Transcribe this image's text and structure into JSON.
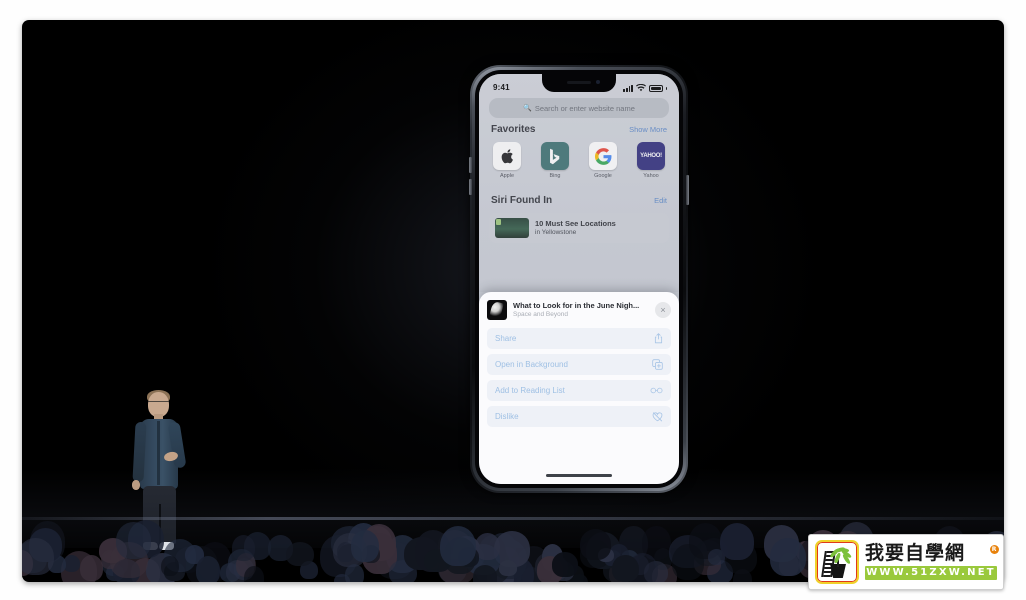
{
  "scene": {
    "description": "Apple WWDC keynote stage with presenter and large screen showing iPhone X Safari start page with context menu",
    "presenter_alt": "presenter standing on stage"
  },
  "phone": {
    "status_bar": {
      "time": "9:41",
      "signal_icon": "cellular-signal-icon",
      "wifi_icon": "wifi-icon",
      "battery_icon": "battery-full-icon"
    },
    "search": {
      "placeholder": "Search or enter website name",
      "icon": "search-icon"
    },
    "favorites": {
      "title": "Favorites",
      "action_label": "Show More",
      "items": [
        {
          "label": "Apple",
          "glyph": "apple-logo-icon"
        },
        {
          "label": "Bing",
          "glyph": "bing-logo-icon"
        },
        {
          "label": "Google",
          "glyph": "google-logo-icon"
        },
        {
          "label": "Yahoo",
          "glyph": "yahoo-logo-icon",
          "text": "YAHOO!"
        }
      ]
    },
    "siri_section": {
      "title": "Siri Found In",
      "action_label": "Edit",
      "item": {
        "title": "10 Must See Locations",
        "subtitle": "in Yellowstone"
      }
    },
    "sheet": {
      "preview": {
        "title": "What to Look for in the June Nigh...",
        "source": "Space and Beyond",
        "close_label": "×",
        "thumb_icon": "article-thumbnail-icon"
      },
      "actions": [
        {
          "label": "Share",
          "icon": "share-icon"
        },
        {
          "label": "Open in Background",
          "icon": "open-in-background-icon"
        },
        {
          "label": "Add to Reading List",
          "icon": "reading-list-glasses-icon"
        },
        {
          "label": "Dislike",
          "icon": "heart-slash-icon"
        }
      ],
      "home_indicator": "home-indicator"
    }
  },
  "watermark": {
    "brand_cn": "我要自學網",
    "registered_mark": "R",
    "url": "WWW.51ZXW.NET",
    "logo_icon": "plant-ladder-logo-icon"
  },
  "colors": {
    "link_blue": "#5b88c9",
    "action_blue": "#9fc0e4",
    "sheet_bg": "#fbfbfd",
    "row_bg": "#eef1f7",
    "bing_teal": "#3a6f6f",
    "yahoo_navy": "#2c2a7a",
    "watermark_green": "#9ac93c",
    "watermark_yellow": "#f0d22a"
  }
}
